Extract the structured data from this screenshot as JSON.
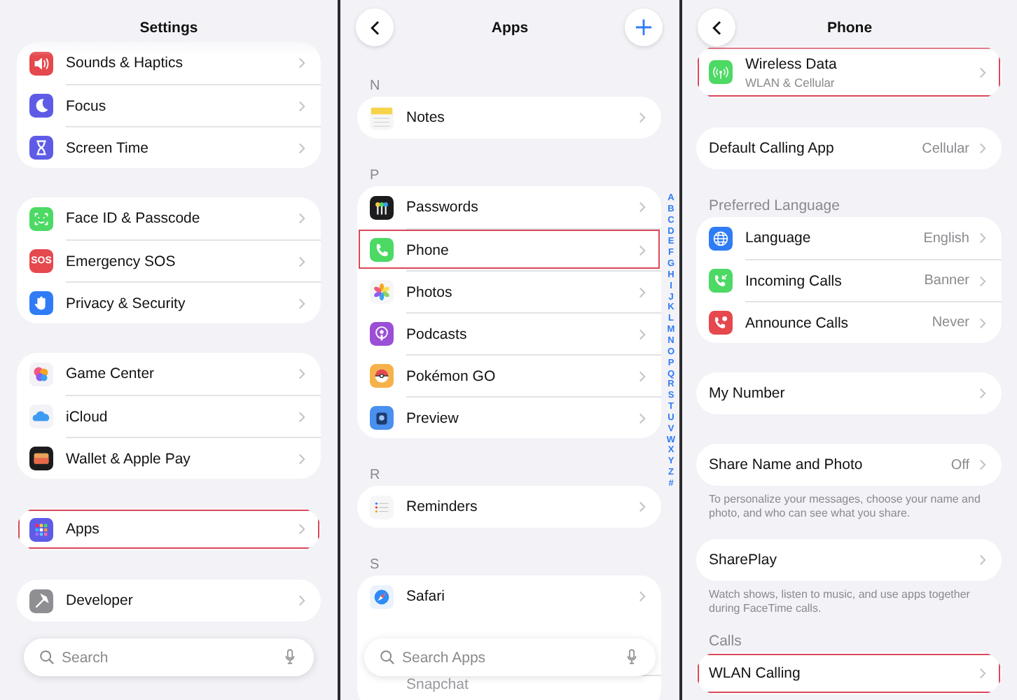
{
  "panels": [
    {
      "title": "Settings",
      "back": false,
      "add": false,
      "sections": [
        {
          "rows": [
            {
              "kind": "speaker",
              "label": "Sounds & Haptics",
              "faded": false,
              "highlighted": false
            },
            {
              "kind": "moon",
              "label": "Focus",
              "faded": false,
              "highlighted": false
            },
            {
              "kind": "hourglass",
              "label": "Screen Time",
              "faded": false,
              "highlighted": false
            }
          ]
        },
        {
          "rows": [
            {
              "kind": "faceid",
              "label": "Face ID & Passcode",
              "faded": false,
              "highlighted": false
            },
            {
              "kind": "sos",
              "icon_text": "SOS",
              "label": "Emergency SOS",
              "faded": false,
              "highlighted": false
            },
            {
              "kind": "hand",
              "label": "Privacy & Security",
              "faded": false,
              "highlighted": false
            }
          ]
        },
        {
          "rows": [
            {
              "kind": "bubbles",
              "label": "Game Center",
              "faded": false,
              "highlighted": false
            },
            {
              "kind": "cloud",
              "label": "iCloud",
              "faded": false,
              "highlighted": false
            },
            {
              "kind": "wallet",
              "label": "Wallet & Apple Pay",
              "faded": false,
              "highlighted": false
            }
          ]
        },
        {
          "rows": [
            {
              "kind": "grid",
              "label": "Apps",
              "faded": false,
              "highlighted": true
            }
          ]
        },
        {
          "rows": [
            {
              "kind": "hammer",
              "label": "Developer",
              "faded": false,
              "highlighted": false
            }
          ]
        }
      ],
      "search": {
        "placeholder": "Search"
      }
    },
    {
      "title": "Apps",
      "back": true,
      "add": true,
      "sections": [
        {
          "header": "N",
          "rows": [
            {
              "kind": "notes",
              "label": "Notes",
              "faded": false,
              "highlighted": false
            }
          ]
        },
        {
          "header": "P",
          "rows": [
            {
              "kind": "keys",
              "label": "Passwords",
              "faded": false,
              "highlighted": false
            },
            {
              "kind": "phone",
              "label": "Phone",
              "faded": false,
              "highlighted": true
            },
            {
              "kind": "flower",
              "label": "Photos",
              "faded": false,
              "highlighted": false
            },
            {
              "kind": "podcast",
              "label": "Podcasts",
              "faded": false,
              "highlighted": false
            },
            {
              "kind": "ball",
              "label": "Pokémon GO",
              "faded": false,
              "highlighted": false
            },
            {
              "kind": "preview",
              "label": "Preview",
              "faded": false,
              "highlighted": false
            }
          ]
        },
        {
          "header": "R",
          "rows": [
            {
              "kind": "list",
              "label": "Reminders",
              "faded": false,
              "highlighted": false
            }
          ]
        },
        {
          "header": "S",
          "rows": [
            {
              "kind": "compass",
              "label": "Safari",
              "faded": false,
              "highlighted": false
            },
            {
              "label": "Snapchat",
              "faded": true,
              "highlighted": false
            }
          ]
        }
      ],
      "index": [
        "A",
        "B",
        "C",
        "D",
        "E",
        "F",
        "G",
        "H",
        "I",
        "J",
        "K",
        "L",
        "M",
        "N",
        "O",
        "P",
        "Q",
        "R",
        "S",
        "T",
        "U",
        "V",
        "W",
        "X",
        "Y",
        "Z",
        "#"
      ],
      "search": {
        "placeholder": "Search Apps"
      }
    },
    {
      "title": "Phone",
      "back": true,
      "add": false,
      "sections": [
        {
          "rows": [
            {
              "kind": "antenna",
              "label": "Wireless Data",
              "subtitle": "WLAN & Cellular",
              "faded": false,
              "highlighted": true
            }
          ]
        },
        {
          "rows": [
            {
              "label": "Default Calling App",
              "value": "Cellular",
              "faded": false,
              "highlighted": false
            }
          ]
        },
        {
          "header": "Preferred Language",
          "rows": [
            {
              "kind": "globe",
              "label": "Language",
              "value": "English",
              "faded": false,
              "highlighted": false
            },
            {
              "kind": "incoming",
              "label": "Incoming Calls",
              "value": "Banner",
              "faded": false,
              "highlighted": false
            },
            {
              "kind": "announce",
              "label": "Announce Calls",
              "value": "Never",
              "faded": false,
              "highlighted": false
            }
          ]
        },
        {
          "rows": [
            {
              "label": "My Number",
              "faded": false,
              "highlighted": false
            }
          ]
        },
        {
          "rows": [
            {
              "label": "Share Name and Photo",
              "value": "Off",
              "faded": false,
              "highlighted": false
            }
          ],
          "footer": "To personalize your messages, choose your name and photo, and who can see what you share."
        },
        {
          "rows": [
            {
              "label": "SharePlay",
              "faded": false,
              "highlighted": false
            }
          ],
          "footer": "Watch shows, listen to music, and use apps together during FaceTime calls."
        },
        {
          "header": "Calls",
          "rows": [
            {
              "label": "WLAN Calling",
              "faded": false,
              "highlighted": true
            }
          ]
        }
      ]
    }
  ]
}
